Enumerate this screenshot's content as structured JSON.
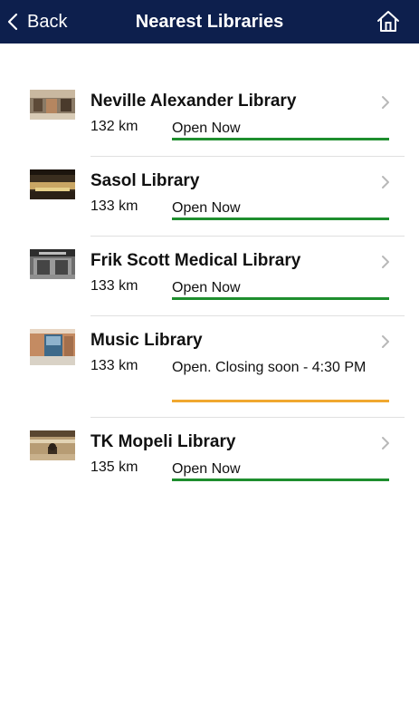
{
  "nav": {
    "back_label": "Back",
    "title": "Nearest Libraries",
    "home_icon": "home-icon",
    "back_icon": "chevron-left-icon"
  },
  "colors": {
    "nav_background": "#0d1f4d",
    "status_open": "#1e8e2e",
    "status_closing_soon": "#f0a830",
    "divider": "#e0e0e0",
    "chevron": "#b8b8b8"
  },
  "libraries": [
    {
      "name": "Neville Alexander Library",
      "distance": "132 km",
      "status": "Open Now",
      "status_type": "open"
    },
    {
      "name": "Sasol Library",
      "distance": "133 km",
      "status": "Open Now",
      "status_type": "open"
    },
    {
      "name": "Frik Scott Medical Library",
      "distance": "133 km",
      "status": "Open Now",
      "status_type": "open"
    },
    {
      "name": "Music Library",
      "distance": "133 km",
      "status": "Open. Closing soon - 4:30 PM",
      "status_type": "closing_soon"
    },
    {
      "name": "TK Mopeli Library",
      "distance": "135 km",
      "status": "Open Now",
      "status_type": "open"
    }
  ]
}
